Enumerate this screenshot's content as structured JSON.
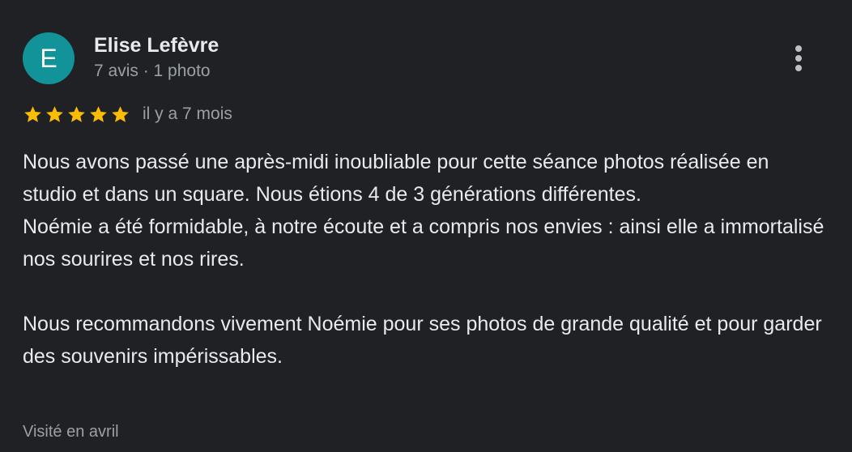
{
  "review": {
    "author": {
      "initial": "E",
      "name": "Elise Lefèvre",
      "meta": "7 avis · 1 photo",
      "avatar_color": "#12939a"
    },
    "rating": {
      "value": 5,
      "max": 5,
      "star_color": "#fbbc04"
    },
    "time_ago": "il y a 7 mois",
    "paragraphs": [
      "Nous avons passé une après-midi inoubliable pour cette séance photos réalisée en studio et dans un square. Nous étions 4 de 3 générations différentes.\nNoémie a été formidable, à notre écoute et a compris nos envies : ainsi elle a immortalisé nos sourires et nos rires.",
      "Nous recommandons vivement Noémie pour ses photos de grande qualité et pour garder des souvenirs impérissables."
    ],
    "visited": "Visité en avril",
    "menu_icon": "more-vert-icon",
    "star_icon": "star-icon"
  }
}
